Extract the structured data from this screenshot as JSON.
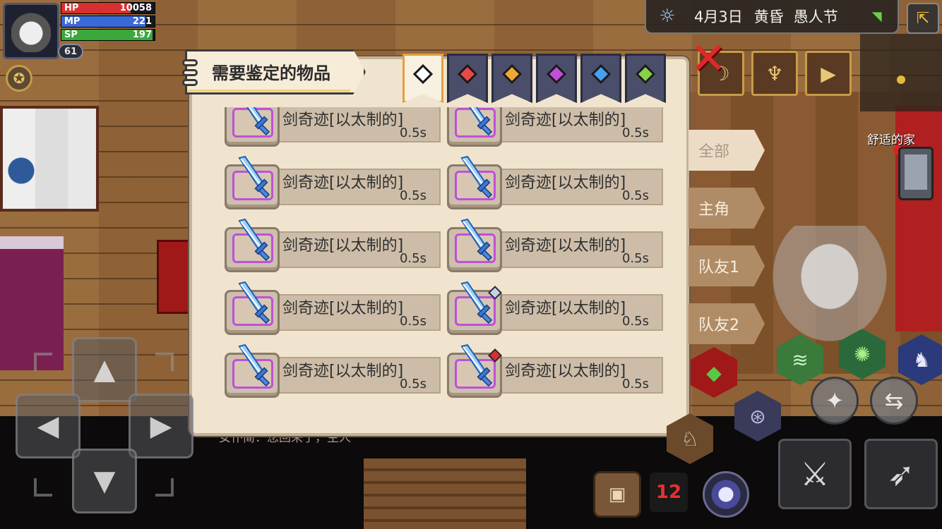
{
  "hud": {
    "hp_label": "HP",
    "hp_value": "10058",
    "hp_fraction": 0.74,
    "mp_label": "MP",
    "mp_value": "221",
    "mp_fraction": 0.9,
    "sp_label": "SP",
    "sp_value": "197",
    "sp_fraction": 0.98,
    "level": "61",
    "colors": {
      "hp": "#d83030",
      "mp": "#3a6ad8",
      "sp": "#3aa83a"
    }
  },
  "info_bar": {
    "weather_icon": "sun-icon",
    "date": "4月3日",
    "period": "黄昏",
    "festival": "愚人节",
    "signal_icon": "wifi-icon"
  },
  "panel": {
    "title": "需要鉴定的物品",
    "gem_tabs": [
      {
        "icon": "gem-all-icon",
        "color": "#ffffff",
        "active": true
      },
      {
        "icon": "gem-red-icon",
        "color": "#e84848",
        "active": false
      },
      {
        "icon": "gem-orange-icon",
        "color": "#f0a830",
        "active": false
      },
      {
        "icon": "gem-purple-icon",
        "color": "#c050d8",
        "active": false
      },
      {
        "icon": "gem-blue-icon",
        "color": "#48a0f0",
        "active": false
      },
      {
        "icon": "gem-green-icon",
        "color": "#88d048",
        "active": false
      }
    ],
    "items": [
      {
        "name": "剑奇迹[以太制的]",
        "time": "0.5s",
        "icon": "ether-sword-icon",
        "mark": ""
      },
      {
        "name": "剑奇迹[以太制的]",
        "time": "0.5s",
        "icon": "ether-sword-icon",
        "mark": ""
      },
      {
        "name": "剑奇迹[以太制的]",
        "time": "0.5s",
        "icon": "ether-sword-icon",
        "mark": ""
      },
      {
        "name": "剑奇迹[以太制的]",
        "time": "0.5s",
        "icon": "ether-sword-icon",
        "mark": ""
      },
      {
        "name": "剑奇迹[以太制的]",
        "time": "0.5s",
        "icon": "ether-sword-icon",
        "mark": ""
      },
      {
        "name": "剑奇迹[以太制的]",
        "time": "0.5s",
        "icon": "ether-sword-icon",
        "mark": ""
      },
      {
        "name": "剑奇迹[以太制的]",
        "time": "0.5s",
        "icon": "ether-sword-icon",
        "mark": ""
      },
      {
        "name": "剑奇迹[以太制的]",
        "time": "0.5s",
        "icon": "ether-sword-icon",
        "mark": "blue-gem"
      },
      {
        "name": "剑奇迹[以太制的]",
        "time": "0.5s",
        "icon": "ether-sword-icon",
        "mark": ""
      },
      {
        "name": "剑奇迹[以太制的]",
        "time": "0.5s",
        "icon": "ether-sword-icon",
        "mark": "red-gem"
      }
    ]
  },
  "filter_tabs": [
    {
      "label": "全部",
      "active": true
    },
    {
      "label": "主角",
      "active": false
    },
    {
      "label": "队友1",
      "active": false
    },
    {
      "label": "队友2",
      "active": false
    }
  ],
  "world": {
    "location_label": "舒适的家",
    "chat_text": "女仆简：您回来了，主人"
  },
  "controls": {
    "swap_label": "12"
  }
}
